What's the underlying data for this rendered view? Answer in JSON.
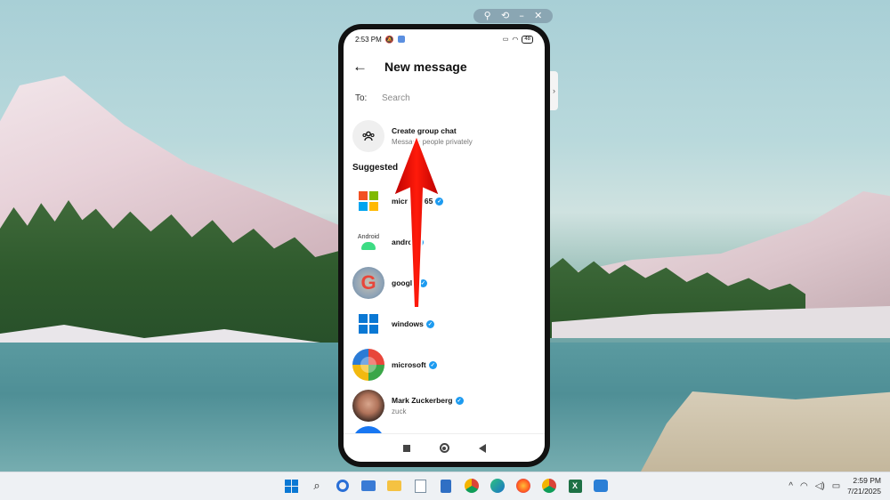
{
  "window_controls": {
    "pin": "⚲",
    "rotate": "⟲",
    "minimize": "–",
    "close": "✕"
  },
  "status_bar": {
    "time": "2:53 PM",
    "battery": "48"
  },
  "header": {
    "title": "New message"
  },
  "to_field": {
    "label": "To:",
    "placeholder": "Search"
  },
  "group_chat": {
    "title": "Create group chat",
    "subtitle": "Message people privately"
  },
  "suggested_heading": "Suggested",
  "android_avatar_text": "Android",
  "suggested": [
    {
      "name": "microsoft365",
      "shown": "micr        65",
      "verified": true,
      "avatar": "microsoft-365-icon"
    },
    {
      "name": "android",
      "shown": "andro",
      "verified": true,
      "avatar": "android-icon"
    },
    {
      "name": "google",
      "shown": "google",
      "verified": true,
      "avatar": "google-icon"
    },
    {
      "name": "windows",
      "shown": "windows",
      "verified": true,
      "avatar": "windows-icon"
    },
    {
      "name": "microsoft",
      "shown": "microsoft",
      "verified": true,
      "avatar": "microsoft-logo-icon"
    },
    {
      "name": "Mark Zuckerberg",
      "shown": "Mark Zuckerberg",
      "username": "zuck",
      "verified": true,
      "avatar": "profile-photo"
    }
  ],
  "taskbar": {
    "apps": [
      "windows-start-icon",
      "search-icon",
      "copilot-icon",
      "widgets-icon",
      "file-explorer-icon",
      "notepad-icon",
      "notes-icon",
      "chrome-icon",
      "edge-icon",
      "firefox-icon",
      "chrome-icon",
      "excel-icon",
      "phone-mirror-icon"
    ],
    "time": "2:59 PM",
    "date": "7/21/2025"
  },
  "colors": {
    "verified": "#1d9bf0",
    "arrow": "#e10600",
    "accent": "#0a78d4"
  }
}
